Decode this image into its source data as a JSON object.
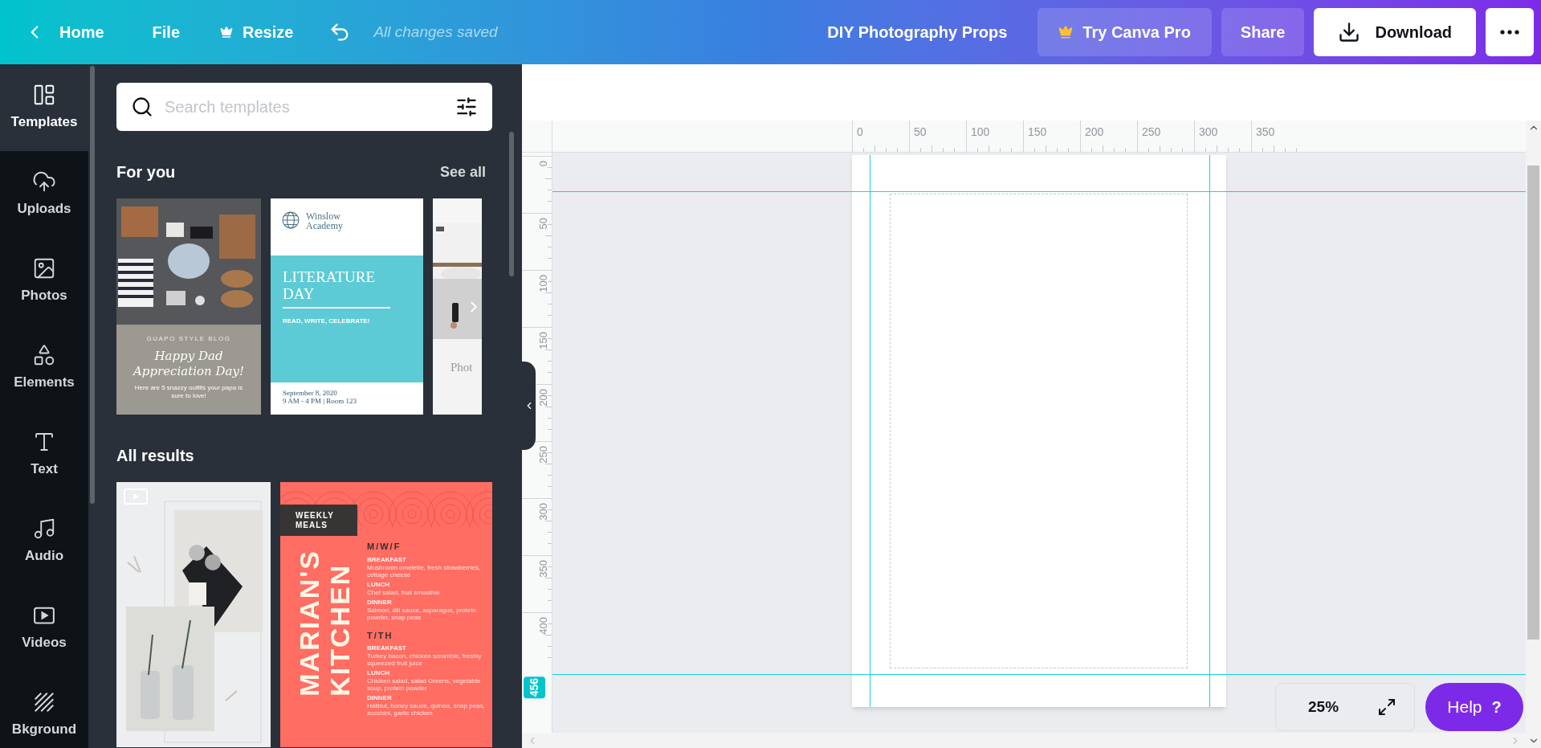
{
  "topbar": {
    "back": "Home",
    "menu": [
      {
        "label": "File",
        "kind": "plain"
      },
      {
        "label": "Resize",
        "kind": "crown"
      }
    ],
    "save_status": "All changes saved",
    "title": "DIY Photography Props",
    "buttons": [
      {
        "label": "Try Canva Pro",
        "kind": "pro"
      },
      {
        "label": "Share",
        "kind": "share"
      },
      {
        "label": "Download",
        "kind": "download"
      },
      {
        "kind": "more"
      }
    ]
  },
  "sidebar": {
    "items": [
      {
        "label": "Templates",
        "selected": true
      },
      {
        "label": "Uploads",
        "selected": false
      },
      {
        "label": "Photos",
        "selected": false
      },
      {
        "label": "Elements",
        "selected": false
      },
      {
        "label": "Text",
        "selected": false
      },
      {
        "label": "Audio",
        "selected": false
      },
      {
        "label": "Videos",
        "selected": false
      },
      {
        "label": "Bkground",
        "selected": false
      }
    ]
  },
  "panel": {
    "search": {
      "placeholder": "Search templates"
    },
    "for_you": {
      "title": "For you",
      "see_all": "See all",
      "templates": [
        {
          "kind": "blog",
          "tagline": "GUAPO STYLE BLOG",
          "title": "Happy Dad Appreciation Day!",
          "body": "Here are 5 snazzy outfits your papa is sure to love!"
        },
        {
          "kind": "school",
          "logo": "Winslow Academy",
          "title": "LITERATURE DAY",
          "subtitle": "READ, WRITE, CELEBRATE!",
          "date": "September 8, 2020",
          "time": "9 AM - 4 PM | Room 123"
        },
        {
          "caption": "Phot"
        }
      ]
    },
    "all_results": {
      "title": "All results",
      "templates": [
        {
          "kind": "video"
        },
        {
          "kind": "menu",
          "badge": "WEEKLY MEALS",
          "title_lines": [
            "MARIAN'S",
            "KITCHEN"
          ],
          "groups": [
            {
              "days": "M/W/F",
              "meals": [
                {
                  "name": "BREAKFAST",
                  "items": "Mushroom omelette, fresh strawberries, cottage cheese"
                },
                {
                  "name": "LUNCH",
                  "items": "Chef salad, fruit smoothie"
                },
                {
                  "name": "DINNER",
                  "items": "Salmon, dill sauce, asparagus, protein powder, snap peas"
                }
              ]
            },
            {
              "days": "T/TH",
              "meals": [
                {
                  "name": "BREAKFAST",
                  "items": "Turkey bacon, chicken scramble, freshly squeezed fruit juice"
                },
                {
                  "name": "LUNCH",
                  "items": "Chicken salad, salad Greens, vegetable soup, protein powder"
                },
                {
                  "name": "DINNER",
                  "items": "Halibut, honey sauce, quinoa, snap peas, zucchini, garlic chicken"
                }
              ]
            }
          ]
        }
      ]
    }
  },
  "rulers": {
    "horizontal": [
      "0",
      "50",
      "100",
      "150",
      "200",
      "250",
      "300",
      "350"
    ],
    "vertical": [
      "0",
      "50",
      "100",
      "150",
      "200",
      "250",
      "300",
      "350",
      "400"
    ],
    "guide_marker": "456"
  },
  "zoom": {
    "value": "25%"
  },
  "help": {
    "label": "Help",
    "icon": "?"
  }
}
